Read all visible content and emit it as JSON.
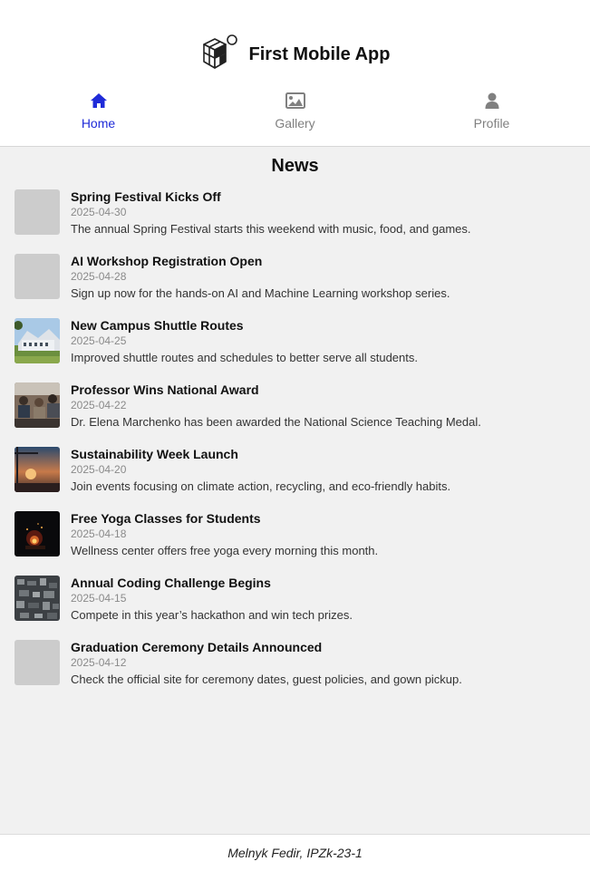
{
  "app": {
    "title": "First Mobile App",
    "logo_icon": "cube-logo-icon"
  },
  "nav": {
    "items": [
      {
        "label": "Home",
        "icon": "home-icon",
        "active": true,
        "color": "#1f2bd8"
      },
      {
        "label": "Gallery",
        "icon": "image-icon",
        "active": false,
        "color": "#808080"
      },
      {
        "label": "Profile",
        "icon": "user-icon",
        "active": false,
        "color": "#808080"
      }
    ]
  },
  "news": {
    "heading": "News",
    "items": [
      {
        "title": "Spring Festival Kicks Off",
        "date": "2025-04-30",
        "description": "The annual Spring Festival starts this weekend with music, food, and games.",
        "thumbnail": "placeholder"
      },
      {
        "title": "AI Workshop Registration Open",
        "date": "2025-04-28",
        "description": "Sign up now for the hands-on AI and Machine Learning workshop series.",
        "thumbnail": "placeholder"
      },
      {
        "title": "New Campus Shuttle Routes",
        "date": "2025-04-25",
        "description": "Improved shuttle routes and schedules to better serve all students.",
        "thumbnail": "campus-building-photo"
      },
      {
        "title": "Professor Wins National Award",
        "date": "2025-04-22",
        "description": "Dr. Elena Marchenko has been awarded the National Science Teaching Medal.",
        "thumbnail": "audience-photo"
      },
      {
        "title": "Sustainability Week Launch",
        "date": "2025-04-20",
        "description": "Join events focusing on climate action, recycling, and eco-friendly habits.",
        "thumbnail": "sunset-photo"
      },
      {
        "title": "Free Yoga Classes for Students",
        "date": "2025-04-18",
        "description": "Wellness center offers free yoga every morning this month.",
        "thumbnail": "night-fire-photo"
      },
      {
        "title": "Annual Coding Challenge Begins",
        "date": "2025-04-15",
        "description": "Compete in this year’s hackathon and win tech prizes.",
        "thumbnail": "aerial-city-photo"
      },
      {
        "title": "Graduation Ceremony Details Announced",
        "date": "2025-04-12",
        "description": "Check the official site for ceremony dates, guest policies, and gown pickup.",
        "thumbnail": "placeholder"
      }
    ]
  },
  "footer": {
    "text": "Melnyk Fedir, IPZk-23-1"
  },
  "colors": {
    "accent": "#1f2bd8",
    "inactive": "#808080",
    "background": "#f1f1f1",
    "placeholder": "#cccccc"
  }
}
